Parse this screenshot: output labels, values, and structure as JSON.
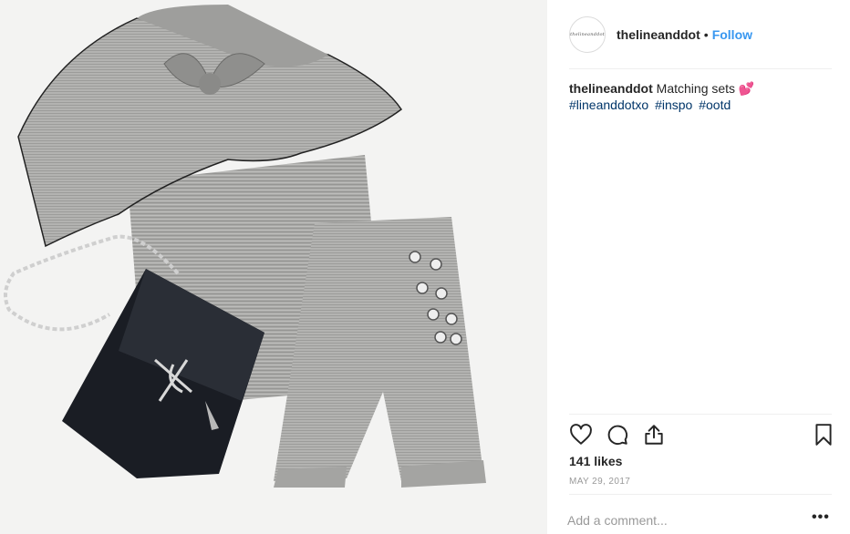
{
  "post": {
    "image_alt": "Grey striped ruffle top, matching shorts and black crossbody bag flat lay"
  },
  "header": {
    "avatar_text": "thelineanddot",
    "username": "thelineanddot",
    "separator": "•",
    "follow_label": "Follow"
  },
  "caption": {
    "username": "thelineanddot",
    "text": "Matching sets 💕",
    "hashtags": [
      "#lineanddotxo",
      "#inspo",
      "#ootd"
    ]
  },
  "actions": {
    "like_icon": "heart-icon",
    "comment_icon": "comment-icon",
    "share_icon": "share-icon",
    "save_icon": "bookmark-icon"
  },
  "stats": {
    "likes": "141 likes",
    "date": "MAY 29, 2017"
  },
  "comment": {
    "placeholder": "Add a comment...",
    "more_label": "•••"
  },
  "colors": {
    "follow": "#3897f0",
    "hashtag": "#003569",
    "text": "#262626",
    "muted": "#999999",
    "divider": "#efefef"
  }
}
